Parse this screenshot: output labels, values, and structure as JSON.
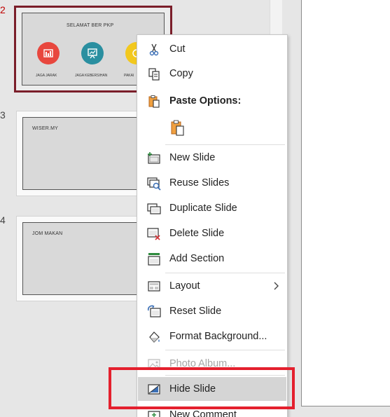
{
  "thumbnails": {
    "slides": [
      {
        "number": "2",
        "title": "SELAMAT BER PKP",
        "icons": [
          {
            "icon": "chart-icon",
            "caption": "JAGA JARAK",
            "color": "#e8473e"
          },
          {
            "icon": "presentation-icon",
            "caption": "JAGA KEBERSIHAN",
            "color": "#2a8fa0"
          },
          {
            "icon": "clock-icon",
            "caption": "PAKAI",
            "color": "#f2c81e"
          }
        ]
      },
      {
        "number": "3",
        "title": "WISER.MY"
      },
      {
        "number": "4",
        "title": "JOM MAKAN"
      }
    ]
  },
  "menu": {
    "cut": "Cut",
    "copy": "Copy",
    "paste_options": "Paste Options:",
    "new_slide": "New Slide",
    "reuse_slides": "Reuse Slides",
    "duplicate_slide": "Duplicate Slide",
    "delete_slide": "Delete Slide",
    "add_section": "Add Section",
    "layout": "Layout",
    "reset_slide": "Reset Slide",
    "format_background": "Format Background...",
    "photo_album": "Photo Album...",
    "hide_slide": "Hide Slide",
    "new_comment": "New Comment"
  },
  "colors": {
    "selection_border": "#7b1e2a",
    "highlight_box": "#e4202e",
    "hover_bg": "#d5d5d5"
  }
}
